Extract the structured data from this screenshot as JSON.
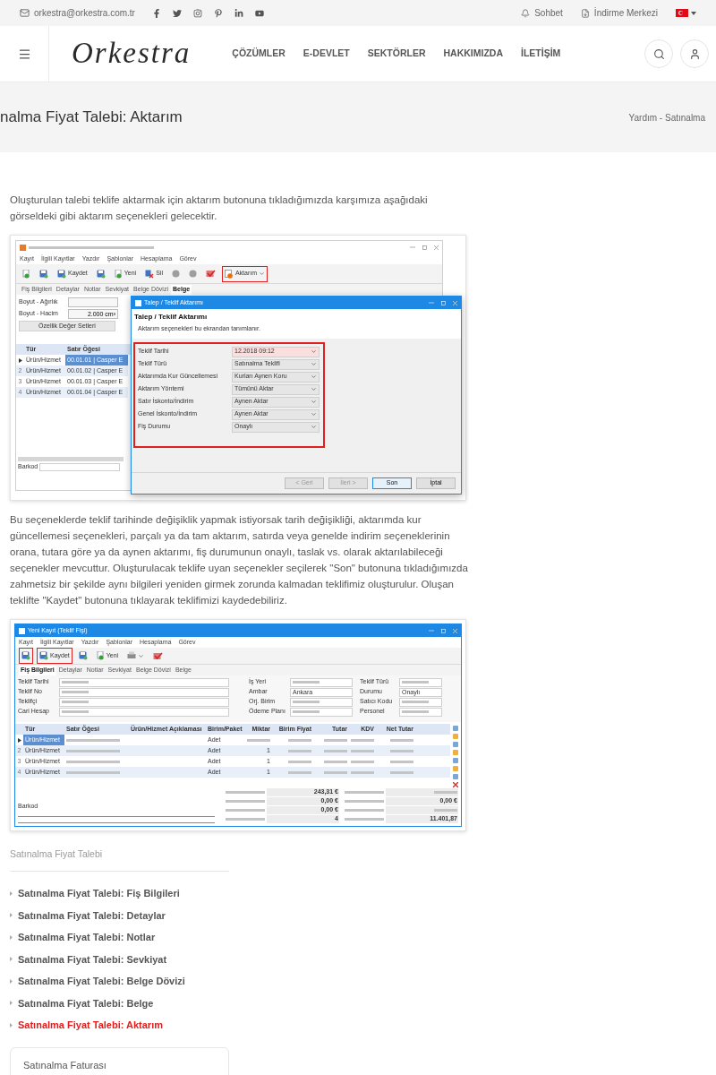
{
  "top_bar": {
    "email": "orkestra@orkestra.com.tr",
    "links": [
      {
        "label": "Sohbet",
        "kind": "chat"
      },
      {
        "label": "İndirme Merkezi",
        "kind": "download"
      }
    ]
  },
  "header": {
    "logo": "Orkestra",
    "nav": [
      "ÇÖZÜMLER",
      "E-DEVLET",
      "SEKTÖRLER",
      "HAKKIMIZDA",
      "İLETİŞİM"
    ]
  },
  "page_title": {
    "title": "nalma Fiyat Talebi: Aktarım",
    "breadcrumb": "Yardım - Satınalma"
  },
  "intro": "Oluşturulan talebi teklife aktarmak için aktarım butonuna tıkladığımızda karşımıza aşağıdaki görseldeki gibi aktarım seçenekleri gelecektir.",
  "screenshot_1": {
    "menu": [
      "Kayıt",
      "İlgili Kayıtlar",
      "Yazdır",
      "Şablonlar",
      "Hesaplama",
      "Görev"
    ],
    "toolbar": [
      {
        "kind": "new",
        "highlighted": false
      },
      {
        "kind": "save",
        "highlighted": false
      },
      {
        "kind": "save",
        "label": "Kaydet",
        "highlighted": false
      },
      {
        "kind": "save",
        "highlighted": false
      },
      {
        "kind": "new",
        "label": "Yeni",
        "highlighted": false
      },
      {
        "kind": "delete",
        "label": "Sil",
        "highlighted": false
      },
      {
        "kind": "round",
        "highlighted": false
      },
      {
        "kind": "round",
        "highlighted": false
      },
      {
        "kind": "approve",
        "highlighted": false
      },
      {
        "kind": "transfer",
        "label": "Aktarım",
        "highlighted": true,
        "dropdown": true
      }
    ],
    "tabs": [
      {
        "label": "Fiş Bilgileri",
        "selected": false
      },
      {
        "label": "Detaylar",
        "selected": false
      },
      {
        "label": "Notlar",
        "selected": false
      },
      {
        "label": "Sevkiyat",
        "selected": false
      },
      {
        "label": "Belge Dövizi",
        "selected": false
      },
      {
        "label": "Belge",
        "selected": true
      }
    ],
    "fields": [
      {
        "label": "Boyut - Ağırlık"
      },
      {
        "label": "Boyut - Hacim",
        "value": "2.000 cm³"
      }
    ],
    "feature_button": "Özellik Değer Setleri",
    "grid": {
      "columns": [
        "Tür",
        "Satır Öğesi"
      ],
      "rows": [
        {
          "cells": [
            "Ürün/Hizmet",
            "00.01.01 | Casper E"
          ],
          "selected": true
        },
        {
          "number": "2",
          "cells": [
            "Ürün/Hizmet",
            "00.01.02 | Casper E"
          ],
          "selected": false
        },
        {
          "number": "3",
          "cells": [
            "Ürün/Hizmet",
            "00.01.03 | Casper E"
          ],
          "selected": false
        },
        {
          "number": "4",
          "cells": [
            "Ürün/Hizmet",
            "00.01.04 | Casper E"
          ],
          "selected": false
        }
      ]
    },
    "barcode_label": "Barkod",
    "dialog": {
      "title": "Talep / Teklif Aktarımı",
      "heading": "Talep / Teklif Aktarımı",
      "subtitle": "Aktarım seçenekleri bu ekrandan tanımlanır.",
      "fields": [
        {
          "label": "Teklif Tarihi",
          "value": "12.2018 09:12",
          "kind": "date"
        },
        {
          "label": "Teklif Türü",
          "value": "Satınalma Teklifi",
          "kind": "select"
        },
        {
          "label": "Aktarımda Kur Güncellemesi",
          "value": "Kurları Aynen Koru",
          "kind": "select"
        },
        {
          "label": "Aktarım Yöntemi",
          "value": "Tümünü Aktar",
          "kind": "select"
        },
        {
          "label": "Satır İskonto/İndirim",
          "value": "Aynen Aktar",
          "kind": "select"
        },
        {
          "label": "Genel İskonto/İndirim",
          "value": "Aynen Aktar",
          "kind": "select"
        },
        {
          "label": "Fiş Durumu",
          "value": "Onaylı",
          "kind": "select"
        }
      ],
      "buttons": [
        {
          "label": "< Geri",
          "disabled": true,
          "focused": false
        },
        {
          "label": "İleri >",
          "disabled": true,
          "focused": false
        },
        {
          "label": "Son",
          "disabled": false,
          "focused": true
        },
        {
          "label": "İptal",
          "disabled": false,
          "focused": false
        }
      ]
    }
  },
  "body": "Bu seçeneklerde teklif tarihinde değişiklik yapmak istiyorsak tarih değişikliği, aktarımda kur güncellemesi seçenekleri, parçalı ya da tam aktarım, satırda veya genelde indirim seçeneklerinin orana, tutara göre ya da aynen aktarımı, fiş durumunun onaylı, taslak vs. olarak aktarılabileceği seçenekler mevcuttur. Oluşturulacak teklife uyan seçenekler seçilerek \"Son\" butonuna tıkladığımızda zahmetsiz bir şekilde aynı bilgileri yeniden girmek zorunda kalmadan teklifimiz oluşturulur. Oluşan teklifte \"Kaydet\" butonuna tıklayarak teklifimizi kaydedebiliriz.",
  "screenshot_2": {
    "window_title": "Yeni Kayıt (Teklif Fişi)",
    "menu": [
      "Kayıt",
      "İlgili Kayıtlar",
      "Yazdır",
      "Şablonlar",
      "Hesaplama",
      "Görev"
    ],
    "toolbar": [
      {
        "kind": "save",
        "highlighted": true
      },
      {
        "kind": "save",
        "label": "Kaydet",
        "highlighted": true
      },
      {
        "kind": "save",
        "highlighted": false
      },
      {
        "kind": "new",
        "label": "Yeni",
        "highlighted": false
      },
      {
        "kind": "print",
        "highlighted": false,
        "dropdown": true
      },
      {
        "kind": "approve",
        "highlighted": false
      }
    ],
    "tabs": [
      {
        "label": "Fiş Bilgileri",
        "selected": true
      },
      {
        "label": "Detaylar",
        "selected": false
      },
      {
        "label": "Notlar",
        "selected": false
      },
      {
        "label": "Sevkiyat",
        "selected": false
      },
      {
        "label": "Belge Dövizi",
        "selected": false
      },
      {
        "label": "Belge",
        "selected": false
      }
    ],
    "left_fields": [
      {
        "label": "Teklif Tarihi"
      },
      {
        "label": "Teklif No"
      },
      {
        "label": "Teklifçi"
      },
      {
        "label": "Cari Hesap"
      }
    ],
    "middle_fields": [
      {
        "label": "İş Yeri"
      },
      {
        "label": "Ambar",
        "value": "Ankara"
      },
      {
        "label": "Orj. Birim"
      },
      {
        "label": "Ödeme Planı"
      }
    ],
    "right_fields": [
      {
        "label": "Teklif Türü"
      },
      {
        "label": "Durumu",
        "value": "Onaylı"
      },
      {
        "label": "Satıcı Kodu"
      },
      {
        "label": "Personel"
      }
    ],
    "grid": {
      "columns": [
        "Tür",
        "Satır Öğesi",
        "Ürün/Hizmet Açıklaması",
        "Birim/Paket",
        "Miktar",
        "Birim Fiyat",
        "Tutar",
        "KDV",
        "Net Tutar"
      ],
      "rows": [
        {
          "type": "Ürün/Hizmet",
          "unit": "Adet",
          "selected": true
        },
        {
          "number": "2",
          "type": "Ürün/Hizmet",
          "unit": "Adet",
          "quantity": "1",
          "selected": false
        },
        {
          "number": "3",
          "type": "Ürün/Hizmet",
          "unit": "Adet",
          "quantity": "1",
          "selected": false
        },
        {
          "number": "4",
          "type": "Ürün/Hizmet",
          "unit": "Adet",
          "quantity": "1",
          "selected": false
        }
      ]
    },
    "barcode_label": "Barkod",
    "totals": [
      {
        "kind": "value",
        "value": "243,31 €"
      },
      {
        "kind": "value",
        "value": "0,00 €"
      },
      {
        "kind": "value",
        "value": "0,00 €"
      },
      {
        "kind": "value",
        "value": "4"
      },
      {
        "kind": "blurred"
      },
      {
        "kind": "value",
        "value": "0,00 €"
      },
      {
        "kind": "blurred"
      },
      {
        "kind": "value",
        "value": "11.401,87"
      }
    ]
  },
  "sidebar": {
    "heading": "Satınalma Fiyat Talebi",
    "links": [
      {
        "label": "Satınalma Fiyat Talebi: Fiş Bilgileri",
        "selected": false
      },
      {
        "label": "Satınalma Fiyat Talebi: Detaylar",
        "selected": false
      },
      {
        "label": "Satınalma Fiyat Talebi: Notlar",
        "selected": false
      },
      {
        "label": "Satınalma Fiyat Talebi: Sevkiyat",
        "selected": false
      },
      {
        "label": "Satınalma Fiyat Talebi: Belge Dövizi",
        "selected": false
      },
      {
        "label": "Satınalma Fiyat Talebi: Belge",
        "selected": false
      },
      {
        "label": "Satınalma Fiyat Talebi: Aktarım",
        "selected": true
      }
    ],
    "next_card": "Satınalma Faturası"
  }
}
